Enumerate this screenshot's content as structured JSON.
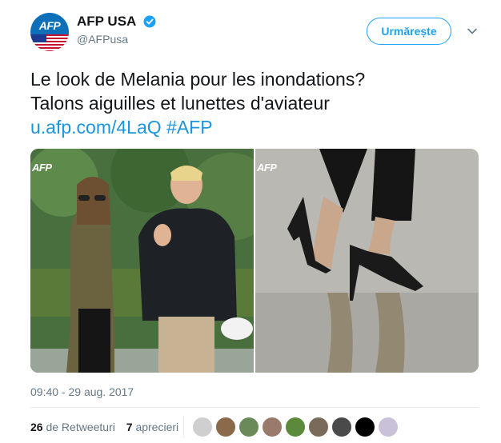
{
  "author": {
    "display_name": "AFP USA",
    "handle": "@AFPusa",
    "avatar_logo": "AFP",
    "verified_icon": "verified-badge-icon"
  },
  "follow_button": {
    "label": "Urmărește"
  },
  "tweet": {
    "line1": "Le look de Melania pour les inondations?",
    "line2": "Talons aiguilles et lunettes d'aviateur",
    "link": "u.afp.com/4LaQ",
    "hashtag": "#AFP"
  },
  "media": {
    "watermark_left": "AFP",
    "watermark_right": "AFP"
  },
  "timestamp": "09:40 - 29 aug. 2017",
  "stats": {
    "retweets_count": "26",
    "retweets_label": "de Retweeturi",
    "likes_count": "7",
    "likes_label": "aprecieri"
  },
  "colors": {
    "accent": "#1da1f2",
    "link": "#1b95e0",
    "muted": "#657786"
  }
}
